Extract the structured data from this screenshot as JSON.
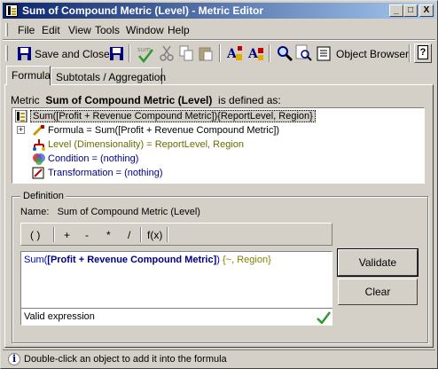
{
  "window": {
    "title": "Sum of Compound Metric (Level) - Metric Editor",
    "minimize_label": "_",
    "maximize_label": "□",
    "close_label": "X"
  },
  "menu": {
    "items": [
      {
        "label": "File"
      },
      {
        "label": "Edit"
      },
      {
        "label": "View"
      },
      {
        "label": "Tools"
      },
      {
        "label": "Window"
      },
      {
        "label": "Help"
      }
    ]
  },
  "toolbar": {
    "save_close_label": "Save and Close",
    "object_browser_label": "Object Browser",
    "help_label": "?"
  },
  "tabs": [
    {
      "label": "Formula",
      "active": true
    },
    {
      "label": "Subtotals / Aggregation",
      "active": false
    }
  ],
  "metric_header": {
    "prefix": "Metric",
    "name": "Sum of Compound Metric (Level)",
    "suffix": "is defined as:"
  },
  "tree": {
    "root": "Sum([Profit + Revenue Compound Metric]){ReportLevel, Region}",
    "expander": "+",
    "children": [
      {
        "label": "Formula = Sum([Profit + Revenue Compound Metric])"
      },
      {
        "label": "Level (Dimensionality) = ReportLevel, Region"
      },
      {
        "label": "Condition = (nothing)"
      },
      {
        "label": "Transformation = (nothing)"
      }
    ]
  },
  "definition": {
    "group_label": "Definition",
    "name_label": "Name:",
    "name_value": "Sum of Compound Metric (Level)",
    "operators": [
      "( )",
      "+",
      "-",
      "*",
      "/",
      "f(x)"
    ],
    "expression": {
      "prefix": "Sum(",
      "bold": "[Profit + Revenue Compound Metric]",
      "close": ")",
      "level": " {~, Region}"
    },
    "status": "Valid expression",
    "validate_label": "Validate",
    "clear_label": "Clear"
  },
  "status_bar": {
    "hint": "Double-click an object to add it into the formula"
  },
  "colors": {
    "title_start": "#0a246a",
    "title_end": "#a6caf0",
    "face": "#d4d0c8",
    "valid_check": "#2e9a2e"
  }
}
